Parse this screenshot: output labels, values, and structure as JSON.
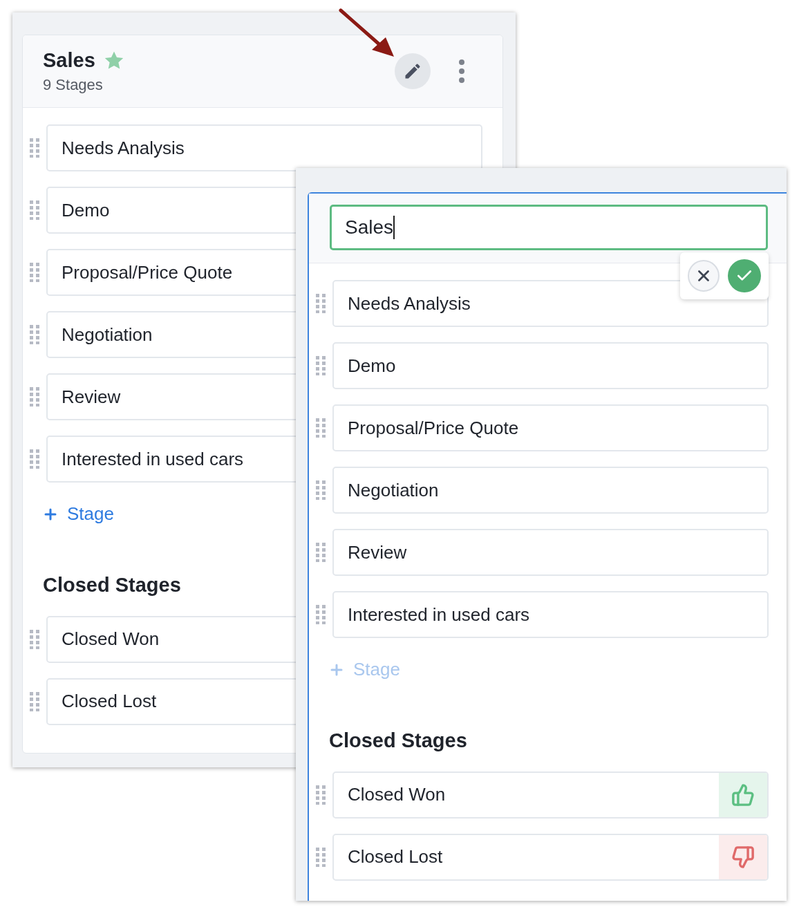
{
  "board": {
    "title": "Sales",
    "favorite": true,
    "stage_count": "9 Stages",
    "stages": [
      "Needs Analysis",
      "Demo",
      "Proposal/Price Quote",
      "Negotiation",
      "Review",
      "Interested in used cars"
    ],
    "add_stage": "Stage",
    "closed_title": "Closed Stages",
    "closed_stages": [
      "Closed Won",
      "Closed Lost"
    ]
  },
  "edit_panel": {
    "name_field": {
      "value": "Sales",
      "focused": true
    },
    "stages": [
      "Needs Analysis",
      "Demo",
      "Proposal/Price Quote",
      "Negotiation",
      "Review",
      "Interested in used cars"
    ],
    "add_stage": {
      "label": "Stage",
      "disabled": true
    },
    "closed_title": "Closed Stages",
    "closed_stages": [
      {
        "label": "Closed Won",
        "kind": "won"
      },
      {
        "label": "Closed Lost",
        "kind": "lost"
      }
    ]
  }
}
